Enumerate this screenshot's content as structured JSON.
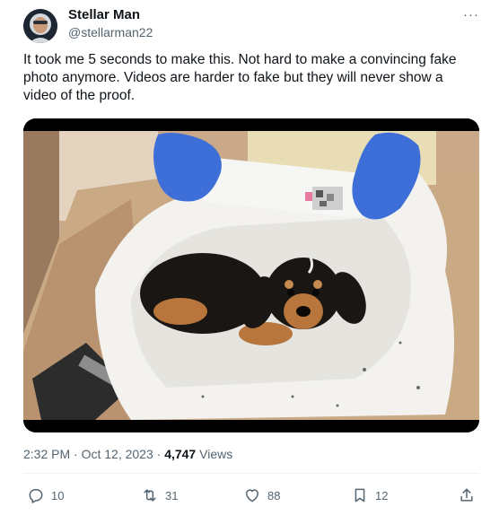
{
  "author": {
    "display_name": "Stellar Man",
    "handle": "@stellarman22",
    "avatar_icon": "astronaut-avatar"
  },
  "more_label": "···",
  "tweet": {
    "text": "It took me 5 seconds to make this. Not hard to make a convincing fake photo anymore. Videos are harder to fake but they will never show a video of the proof."
  },
  "meta": {
    "timestamp": "2:32 PM · Oct 12, 2023 · ",
    "views_count": "4,747",
    "views_label": " Views"
  },
  "actions": {
    "replies": "10",
    "retweets": "31",
    "likes": "88",
    "bookmarks": "12"
  },
  "colors": {
    "text_primary": "#0f1419",
    "text_secondary": "#536471",
    "divider": "#eff3f4",
    "glove_blue": "#3e6fd8"
  }
}
